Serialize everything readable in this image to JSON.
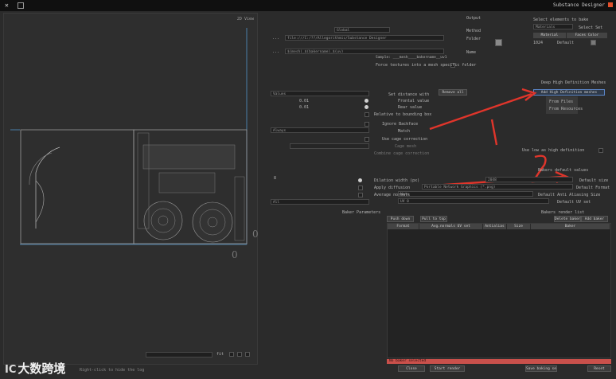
{
  "titlebar": {
    "title": "Substance Designer",
    "close_glyph": "✕"
  },
  "viewport": {
    "label": "2D View",
    "zero_a": "0",
    "zero_b": "0",
    "zoom": "fit"
  },
  "output": {
    "header": "Output",
    "method_label": "Method",
    "method_value": "Global",
    "folder_label": "Folder",
    "folder_value": "file:///C:/??/Allegorithmic/Substance Designer",
    "name_label": "Name",
    "name_value": "$(mesh)_$(bakername)_$(uv)",
    "name_sample": "Sample: ___mesh____bakername__uv1",
    "force_label": "Force textures into a mesh specific folder",
    "ellipsis": "..."
  },
  "select": {
    "header": "Select elements to bake",
    "select_set_label": "Select Set",
    "select_set_value": "Materials",
    "col_material": "Material",
    "col_faces": "Faces Color",
    "row_name": "Default",
    "row_value": "1024"
  },
  "deep": {
    "header": "Deep High Definition Meshes",
    "add_button": "Add High Definition meshes",
    "menu": [
      "From Files",
      "From Resources"
    ],
    "remove_all": "Remove all",
    "set_distance": "Set distance with",
    "set_distance_value": "Values",
    "frontal": "Frontal value",
    "frontal_value": "0.01",
    "rear": "Rear value",
    "rear_value": "0.01",
    "relative": "Relative to bounding box",
    "ignore_backface": "Ignore Backface",
    "match": "Match",
    "match_value": "Always",
    "cage": "Use cage correction",
    "cage_file": "Cage mesh",
    "smooth": "Combine cage correction",
    "use_low": "Use low as high definition",
    "annotation_1": "1",
    "annotation_2": "2"
  },
  "defaults": {
    "header": "Bakers default values",
    "size_label": "Default size",
    "size_value": "2048",
    "format_label": "Default Format",
    "format_value": "Portable Network Graphics (*.png)",
    "aa_label": "Default Anti Aliasing Size",
    "aa_value": "None",
    "uv_label": "Default UV set",
    "uv_value": "UV 0",
    "dilation_label": "Dilation width (px)",
    "dilation_value": "8",
    "apply_label": "Apply diffusion",
    "bake_label": "Average normals",
    "all_label": "All"
  },
  "bakers": {
    "header": "Baker Parameters",
    "list_header": "Bakers render list",
    "add_button": "Add baker",
    "delete_button": "Delete baker",
    "pull_button": "Pull to top",
    "push_button": "Push down",
    "columns": [
      "Baker",
      "Size",
      "Antialias",
      "Avg.normals UV set",
      "Format"
    ],
    "status": "No baker selected"
  },
  "footer": {
    "close": "Close",
    "start": "Start render",
    "save": "Save baking setup",
    "reset": "Reset",
    "left_text": "Right-click to hide the log"
  },
  "watermark": {
    "icon_text": "IC",
    "text": "大数跨境"
  }
}
